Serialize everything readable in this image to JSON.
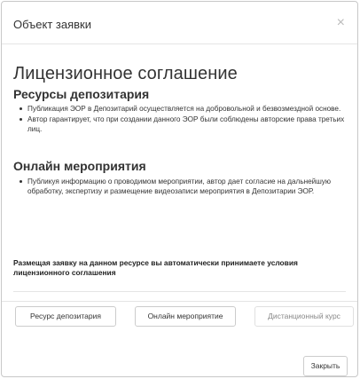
{
  "modal": {
    "title": "Объект заявки",
    "close_symbol": "×"
  },
  "agreement": {
    "title": "Лицензионное соглашение",
    "sections": [
      {
        "title": "Ресурсы депозитария",
        "items": [
          "Публикация ЭОР в Депозитарий осуществляется на добровольной и безвозмездной основе.",
          "Автор гарантирует, что при создании данного ЭОР были соблюдены авторские права третьих лиц."
        ]
      },
      {
        "title": "Онлайн мероприятия",
        "items": [
          "Публикуя информацию о проводимом мероприятии, автор дает согласие на дальнейшую обработку, экспертизу и размещение видеозаписи мероприятия в Депозитарии ЭОР."
        ]
      }
    ],
    "notice": "Размещая заявку на данном ресурсе вы автоматически принимаете условия лицензионного соглашения"
  },
  "buttons": {
    "depository_resource": "Ресурс депозитария",
    "online_event": "Онлайн мероприятие",
    "distance_course": "Дистанционный курс",
    "close": "Закрыть"
  },
  "colors": {
    "border": "#cccccc",
    "text": "#333333",
    "disabled_text": "#888888"
  }
}
